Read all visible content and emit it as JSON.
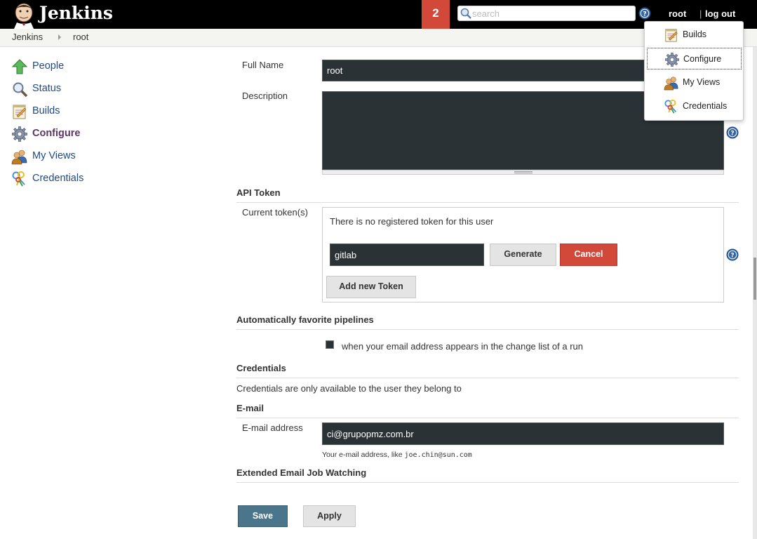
{
  "header": {
    "brand": "Jenkins",
    "badge_count": "2",
    "search_placeholder": "search",
    "user": "root",
    "separator": "|",
    "logout": "log out"
  },
  "breadcrumb": {
    "items": [
      "Jenkins",
      "root"
    ]
  },
  "sidebar": {
    "items": [
      {
        "label": "People",
        "icon": "up-arrow-icon"
      },
      {
        "label": "Status",
        "icon": "magnifier-icon"
      },
      {
        "label": "Builds",
        "icon": "notepad-icon"
      },
      {
        "label": "Configure",
        "icon": "gear-icon",
        "active": true
      },
      {
        "label": "My Views",
        "icon": "users-icon"
      },
      {
        "label": "Credentials",
        "icon": "keys-icon"
      }
    ]
  },
  "dropdown": {
    "items": [
      "Builds",
      "Configure",
      "My Views",
      "Credentials"
    ],
    "highlighted": "Configure"
  },
  "form": {
    "full_name_label": "Full Name",
    "full_name_value": "root",
    "description_label": "Description",
    "description_value": "",
    "api_token_title": "API Token",
    "current_tokens_label": "Current token(s)",
    "no_token_text": "There is no registered token for this user",
    "token_name_value": "gitlab",
    "generate_label": "Generate",
    "cancel_label": "Cancel",
    "add_token_label": "Add new Token",
    "fav_title": "Automatically favorite pipelines",
    "fav_checkbox_label": "when your email address appears in the change list of a run",
    "credentials_title": "Credentials",
    "credentials_text": "Credentials are only available to the user they belong to",
    "email_title": "E-mail",
    "email_label": "E-mail address",
    "email_value": "ci@grupopmz.com.br",
    "email_hint_prefix": "Your e-mail address, like ",
    "email_hint_example": "joe.chin@sun.com",
    "ext_email_title": "Extended Email Job Watching",
    "save_label": "Save",
    "apply_label": "Apply"
  },
  "colors": {
    "header_bg": "#000000",
    "badge_bg": "#d24939",
    "input_bg": "#2b3236",
    "cancel_bg": "#d24939",
    "save_bg": "#4b758b",
    "link": "#204a87",
    "active_link": "#5c3566"
  }
}
